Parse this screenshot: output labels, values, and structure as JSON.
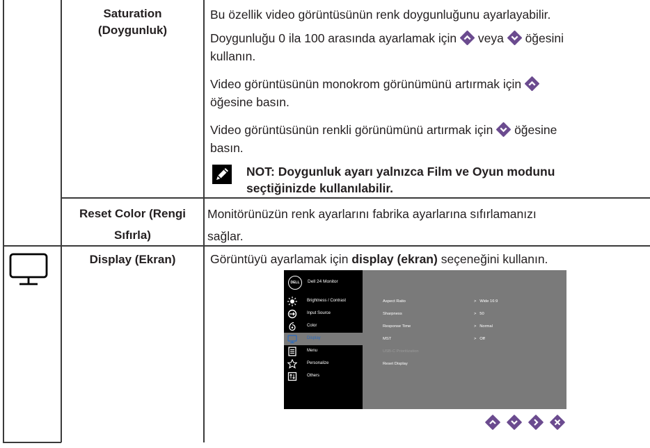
{
  "rows": {
    "saturation": {
      "feature_line1": "Saturation",
      "feature_line2": "(Doygunluk)",
      "p1": "Bu özellik video görüntüsünün renk doygunluğunu ayarlayabilir.",
      "p2_a": "Doygunluğu 0 ila 100 arasında ayarlamak için",
      "p2_b": "veya",
      "p2_c": "öğesini",
      "p2_d": "kullanın.",
      "p3_a": "Video görüntüsünün monokrom görünümünü artırmak için",
      "p3_b": "öğesine basın.",
      "p4_a": "Video görüntüsünün renkli görünümünü artırmak için",
      "p4_b": "öğesine",
      "p4_c": "basın.",
      "note_line1": "NOT: Doygunluk ayarı yalnızca Film ve Oyun modunu",
      "note_line2": "seçtiğinizde kullanılabilir."
    },
    "reset_color": {
      "feature_line1": "Reset Color (Rengi",
      "feature_line2": "Sıfırla)",
      "desc_line1": "Monitörünüzün renk ayarlarını fabrika ayarlarına sıfırlamanızı",
      "desc_line2": "sağlar."
    },
    "display": {
      "feature": "Display (Ekran)",
      "desc_a": "Görüntüyü ayarlamak için",
      "desc_bold": "display (ekran)",
      "desc_b": "seçeneğini kullanın.",
      "icon": "monitor-icon"
    }
  },
  "osd": {
    "logo": "DELL",
    "title": "Dell 24 Monitor",
    "menu": [
      {
        "label": "Brightness / Contrast",
        "icon": "brightness-icon"
      },
      {
        "label": "Input Source",
        "icon": "input-source-icon"
      },
      {
        "label": "Color",
        "icon": "color-icon"
      },
      {
        "label": "Display",
        "icon": "display-icon"
      },
      {
        "label": "Menu",
        "icon": "menu-icon"
      },
      {
        "label": "Personalize",
        "icon": "star-icon"
      },
      {
        "label": "Others",
        "icon": "others-icon"
      }
    ],
    "selected_index": 3,
    "settings": [
      {
        "label": "Aspect Ratio",
        "value": "Wide 16:9"
      },
      {
        "label": "Sharpness",
        "value": "50"
      },
      {
        "label": "Response Time",
        "value": "Normal"
      },
      {
        "label": "MST",
        "value": "Off"
      },
      {
        "label": "USB-C Prioritization",
        "value": ""
      },
      {
        "label": "Reset Display",
        "value": ""
      }
    ],
    "nav_buttons": [
      "up-icon",
      "down-icon",
      "right-icon",
      "close-icon"
    ]
  },
  "colors": {
    "accent": "#6b4b8f",
    "osd_panel": "#7a7a7a",
    "osd_menu": "#000000",
    "selected_text": "#2a6bbf"
  }
}
